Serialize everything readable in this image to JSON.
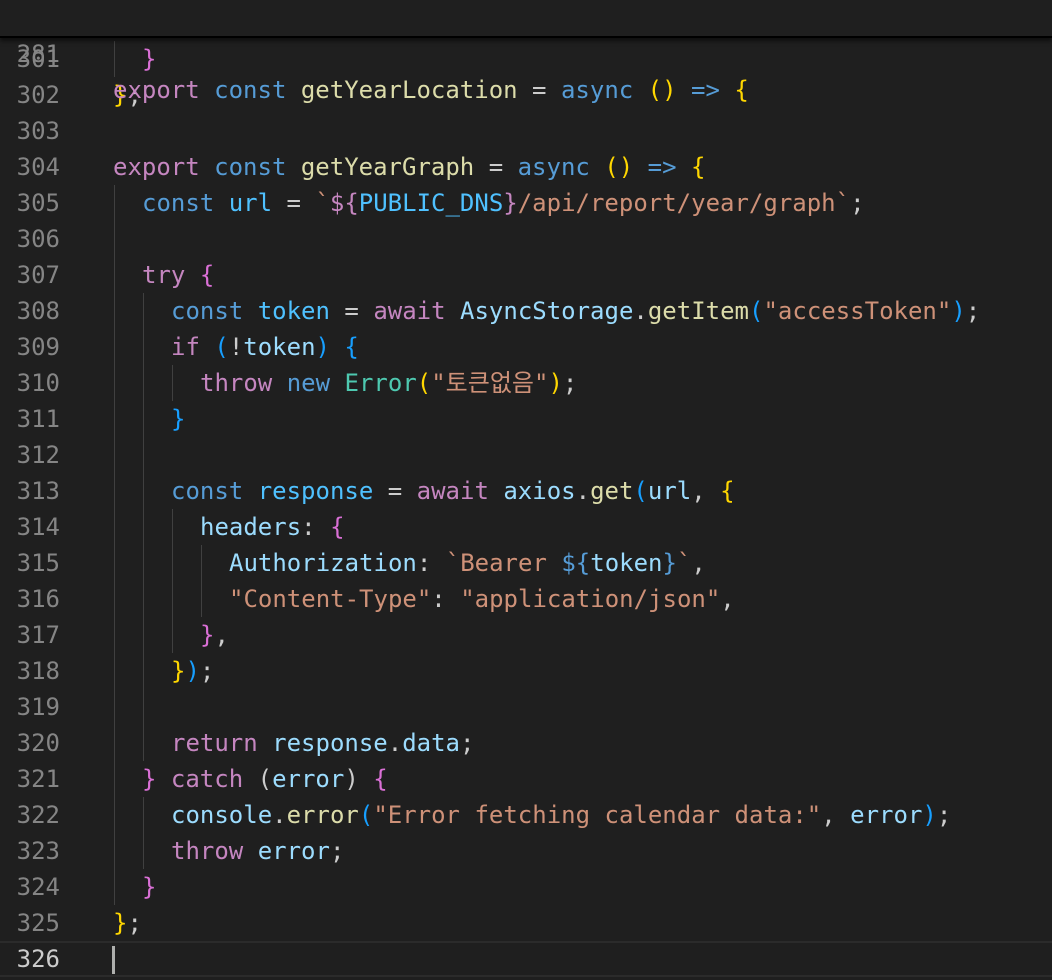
{
  "editor": {
    "sticky_line": {
      "number": "281",
      "tokens": [
        {
          "t": "export",
          "c": "ctl"
        },
        {
          "t": " ",
          "c": "pu"
        },
        {
          "t": "const",
          "c": "kw"
        },
        {
          "t": " ",
          "c": "pu"
        },
        {
          "t": "getYearLocation",
          "c": "fn"
        },
        {
          "t": " = ",
          "c": "pu"
        },
        {
          "t": "async",
          "c": "kw"
        },
        {
          "t": " ",
          "c": "pu"
        },
        {
          "t": "()",
          "c": "b1"
        },
        {
          "t": " ",
          "c": "pu"
        },
        {
          "t": "=>",
          "c": "kw"
        },
        {
          "t": " ",
          "c": "pu"
        },
        {
          "t": "{",
          "c": "b1"
        }
      ]
    },
    "lines": [
      {
        "number": "301",
        "indent": 1,
        "tokens": [
          {
            "t": "}",
            "c": "b2"
          }
        ]
      },
      {
        "number": "302",
        "indent": 0,
        "tokens": [
          {
            "t": "}",
            "c": "b1"
          },
          {
            "t": ";",
            "c": "pu"
          }
        ]
      },
      {
        "number": "303",
        "indent": 0,
        "tokens": []
      },
      {
        "number": "304",
        "indent": 0,
        "tokens": [
          {
            "t": "export",
            "c": "ctl"
          },
          {
            "t": " ",
            "c": "pu"
          },
          {
            "t": "const",
            "c": "kw"
          },
          {
            "t": " ",
            "c": "pu"
          },
          {
            "t": "getYearGraph",
            "c": "fn"
          },
          {
            "t": " = ",
            "c": "pu"
          },
          {
            "t": "async",
            "c": "kw"
          },
          {
            "t": " ",
            "c": "pu"
          },
          {
            "t": "()",
            "c": "b1"
          },
          {
            "t": " ",
            "c": "pu"
          },
          {
            "t": "=>",
            "c": "kw"
          },
          {
            "t": " ",
            "c": "pu"
          },
          {
            "t": "{",
            "c": "b1"
          }
        ]
      },
      {
        "number": "305",
        "indent": 1,
        "tokens": [
          {
            "t": "const",
            "c": "kw"
          },
          {
            "t": " ",
            "c": "pu"
          },
          {
            "t": "url",
            "c": "cn"
          },
          {
            "t": " = ",
            "c": "pu"
          },
          {
            "t": "`",
            "c": "str"
          },
          {
            "t": "${",
            "c": "ctl"
          },
          {
            "t": "PUBLIC_DNS",
            "c": "cn"
          },
          {
            "t": "}",
            "c": "ctl"
          },
          {
            "t": "/api/report/year/graph`",
            "c": "str"
          },
          {
            "t": ";",
            "c": "pu"
          }
        ]
      },
      {
        "number": "306",
        "indent": 1,
        "tokens": []
      },
      {
        "number": "307",
        "indent": 1,
        "tokens": [
          {
            "t": "try",
            "c": "ctl"
          },
          {
            "t": " ",
            "c": "pu"
          },
          {
            "t": "{",
            "c": "b2"
          }
        ]
      },
      {
        "number": "308",
        "indent": 2,
        "tokens": [
          {
            "t": "const",
            "c": "kw"
          },
          {
            "t": " ",
            "c": "pu"
          },
          {
            "t": "token",
            "c": "cn"
          },
          {
            "t": " = ",
            "c": "pu"
          },
          {
            "t": "await",
            "c": "ctl"
          },
          {
            "t": " ",
            "c": "pu"
          },
          {
            "t": "AsyncStorage",
            "c": "vr"
          },
          {
            "t": ".",
            "c": "pu"
          },
          {
            "t": "getItem",
            "c": "fn"
          },
          {
            "t": "(",
            "c": "b3"
          },
          {
            "t": "\"accessToken\"",
            "c": "str"
          },
          {
            "t": ")",
            "c": "b3"
          },
          {
            "t": ";",
            "c": "pu"
          }
        ]
      },
      {
        "number": "309",
        "indent": 2,
        "tokens": [
          {
            "t": "if",
            "c": "ctl"
          },
          {
            "t": " ",
            "c": "pu"
          },
          {
            "t": "(",
            "c": "b3"
          },
          {
            "t": "!",
            "c": "pu"
          },
          {
            "t": "token",
            "c": "vr"
          },
          {
            "t": ")",
            "c": "b3"
          },
          {
            "t": " ",
            "c": "pu"
          },
          {
            "t": "{",
            "c": "b3"
          }
        ]
      },
      {
        "number": "310",
        "indent": 3,
        "tokens": [
          {
            "t": "throw",
            "c": "ctl"
          },
          {
            "t": " ",
            "c": "pu"
          },
          {
            "t": "new",
            "c": "kw"
          },
          {
            "t": " ",
            "c": "pu"
          },
          {
            "t": "Error",
            "c": "cls"
          },
          {
            "t": "(",
            "c": "b1"
          },
          {
            "t": "\"토큰없음\"",
            "c": "str"
          },
          {
            "t": ")",
            "c": "b1"
          },
          {
            "t": ";",
            "c": "pu"
          }
        ]
      },
      {
        "number": "311",
        "indent": 2,
        "tokens": [
          {
            "t": "}",
            "c": "b3"
          }
        ]
      },
      {
        "number": "312",
        "indent": 2,
        "tokens": []
      },
      {
        "number": "313",
        "indent": 2,
        "tokens": [
          {
            "t": "const",
            "c": "kw"
          },
          {
            "t": " ",
            "c": "pu"
          },
          {
            "t": "response",
            "c": "cn"
          },
          {
            "t": " = ",
            "c": "pu"
          },
          {
            "t": "await",
            "c": "ctl"
          },
          {
            "t": " ",
            "c": "pu"
          },
          {
            "t": "axios",
            "c": "vr"
          },
          {
            "t": ".",
            "c": "pu"
          },
          {
            "t": "get",
            "c": "fn"
          },
          {
            "t": "(",
            "c": "b3"
          },
          {
            "t": "url",
            "c": "vr"
          },
          {
            "t": ", ",
            "c": "pu"
          },
          {
            "t": "{",
            "c": "b1"
          }
        ]
      },
      {
        "number": "314",
        "indent": 3,
        "tokens": [
          {
            "t": "headers",
            "c": "vr"
          },
          {
            "t": ": ",
            "c": "pu"
          },
          {
            "t": "{",
            "c": "b2"
          }
        ]
      },
      {
        "number": "315",
        "indent": 4,
        "tokens": [
          {
            "t": "Authorization",
            "c": "vr"
          },
          {
            "t": ": ",
            "c": "pu"
          },
          {
            "t": "`Bearer ",
            "c": "str"
          },
          {
            "t": "${",
            "c": "kw"
          },
          {
            "t": "token",
            "c": "vr"
          },
          {
            "t": "}",
            "c": "kw"
          },
          {
            "t": "`",
            "c": "str"
          },
          {
            "t": ",",
            "c": "pu"
          }
        ]
      },
      {
        "number": "316",
        "indent": 4,
        "tokens": [
          {
            "t": "\"Content-Type\"",
            "c": "str"
          },
          {
            "t": ": ",
            "c": "pu"
          },
          {
            "t": "\"application/json\"",
            "c": "str"
          },
          {
            "t": ",",
            "c": "pu"
          }
        ]
      },
      {
        "number": "317",
        "indent": 3,
        "tokens": [
          {
            "t": "}",
            "c": "b2"
          },
          {
            "t": ",",
            "c": "pu"
          }
        ]
      },
      {
        "number": "318",
        "indent": 2,
        "tokens": [
          {
            "t": "}",
            "c": "b1"
          },
          {
            "t": ")",
            "c": "b3"
          },
          {
            "t": ";",
            "c": "pu"
          }
        ]
      },
      {
        "number": "319",
        "indent": 2,
        "tokens": []
      },
      {
        "number": "320",
        "indent": 2,
        "tokens": [
          {
            "t": "return",
            "c": "ctl"
          },
          {
            "t": " ",
            "c": "pu"
          },
          {
            "t": "response",
            "c": "vr"
          },
          {
            "t": ".",
            "c": "pu"
          },
          {
            "t": "data",
            "c": "vr"
          },
          {
            "t": ";",
            "c": "pu"
          }
        ]
      },
      {
        "number": "321",
        "indent": 1,
        "tokens": [
          {
            "t": "}",
            "c": "b2"
          },
          {
            "t": " ",
            "c": "pu"
          },
          {
            "t": "catch",
            "c": "ctl"
          },
          {
            "t": " ",
            "c": "pu"
          },
          {
            "t": "(",
            "c": "pu"
          },
          {
            "t": "error",
            "c": "vr"
          },
          {
            "t": ")",
            "c": "pu"
          },
          {
            "t": " ",
            "c": "pu"
          },
          {
            "t": "{",
            "c": "b2"
          }
        ]
      },
      {
        "number": "322",
        "indent": 2,
        "tokens": [
          {
            "t": "console",
            "c": "vr"
          },
          {
            "t": ".",
            "c": "pu"
          },
          {
            "t": "error",
            "c": "fn"
          },
          {
            "t": "(",
            "c": "b3"
          },
          {
            "t": "\"Error fetching calendar data:\"",
            "c": "str"
          },
          {
            "t": ", ",
            "c": "pu"
          },
          {
            "t": "error",
            "c": "vr"
          },
          {
            "t": ")",
            "c": "b3"
          },
          {
            "t": ";",
            "c": "pu"
          }
        ]
      },
      {
        "number": "323",
        "indent": 2,
        "tokens": [
          {
            "t": "throw",
            "c": "ctl"
          },
          {
            "t": " ",
            "c": "pu"
          },
          {
            "t": "error",
            "c": "vr"
          },
          {
            "t": ";",
            "c": "pu"
          }
        ]
      },
      {
        "number": "324",
        "indent": 1,
        "tokens": [
          {
            "t": "}",
            "c": "b2"
          }
        ]
      },
      {
        "number": "325",
        "indent": 0,
        "tokens": [
          {
            "t": "}",
            "c": "b1"
          },
          {
            "t": ";",
            "c": "pu"
          }
        ]
      },
      {
        "number": "326",
        "indent": 0,
        "tokens": [],
        "current": true
      }
    ]
  },
  "colors": {
    "background": "#1f1f1f",
    "line_number": "#858585",
    "active_line_number": "#cccccc",
    "indent_guide": "#404040",
    "cursor": "#aeafad"
  }
}
